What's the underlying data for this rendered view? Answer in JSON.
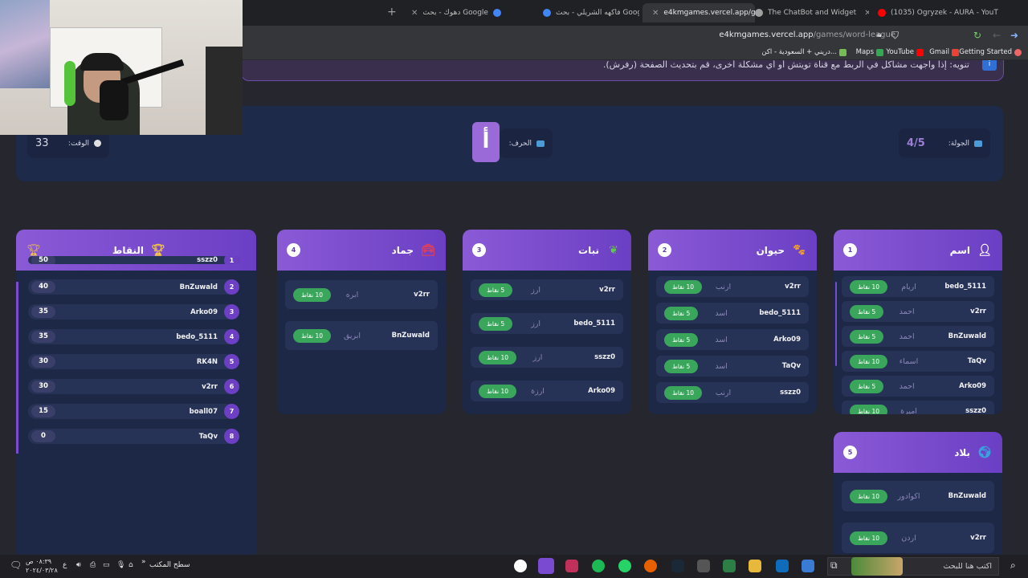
{
  "browser": {
    "tabs": [
      {
        "label": "مرحباً، الرئيسي - Ogryzek - AURA - (1035)",
        "display": "(1035) Ogryzek - AURA - YouT"
      },
      {
        "label": "The ChatBot and Widget",
        "display": "The ChatBot and Widget"
      },
      {
        "label": "e4kmgames.vercel.app/games",
        "display": "e4kmgames.vercel.app/game"
      },
      {
        "label": "فاكهه الشريلي - بحث Google",
        "display": "فاكهه الشريلي - بحث Google"
      },
      {
        "label": "دهوك - بحث Google",
        "display": "دهوك - بحث Google"
      }
    ],
    "url_domain": "e4kmgames.vercel.app",
    "url_path": "/games/word-league",
    "bookmarks": [
      "Getting Started",
      "Gmail",
      "YouTube",
      "Maps",
      "دريني + السعودية - اكن..."
    ]
  },
  "notice": {
    "text": "تنويه: إذا واجهت مشاكل في الربط مع قناة تويتش أو أي مشكلة أخرى، قم بتحديث الصفحة (رفرش)."
  },
  "header": {
    "round_label": "الجولة:",
    "round_value": "4/5",
    "letter_label": "الحرف:",
    "letter": "أ",
    "time_label": "الوقت:",
    "time_value": "33"
  },
  "categories": [
    {
      "number": "1",
      "title": "اسم",
      "icon": "person-icon",
      "rows": [
        {
          "name": "bedo_5111",
          "word": "اريام",
          "points": "10 نقاط"
        },
        {
          "name": "v2rr",
          "word": "احمد",
          "points": "5 نقاط"
        },
        {
          "name": "BnZuwald",
          "word": "احمد",
          "points": "5 نقاط"
        },
        {
          "name": "TaQv",
          "word": "اسماء",
          "points": "10 نقاط"
        },
        {
          "name": "Arko09",
          "word": "احمد",
          "points": "5 نقاط"
        },
        {
          "name": "sszz0",
          "word": "اميرة",
          "points": "10 نقاط"
        }
      ]
    },
    {
      "number": "2",
      "title": "حيوان",
      "icon": "paw-icon",
      "rows": [
        {
          "name": "v2rr",
          "word": "ارنب",
          "points": "10 نقاط"
        },
        {
          "name": "bedo_5111",
          "word": "اسد",
          "points": "5 نقاط"
        },
        {
          "name": "Arko09",
          "word": "اسد",
          "points": "5 نقاط"
        },
        {
          "name": "TaQv",
          "word": "اسد",
          "points": "5 نقاط"
        },
        {
          "name": "sszz0",
          "word": "ارنب",
          "points": "10 نقاط"
        }
      ]
    },
    {
      "number": "3",
      "title": "نبات",
      "icon": "leaf-icon",
      "rows": [
        {
          "name": "v2rr",
          "word": "ارز",
          "points": "5 نقاط"
        },
        {
          "name": "bedo_5111",
          "word": "ارز",
          "points": "5 نقاط"
        },
        {
          "name": "sszz0",
          "word": "ارز",
          "points": "10 نقاط"
        },
        {
          "name": "Arko09",
          "word": "ارزة",
          "points": "10 نقاط"
        }
      ]
    },
    {
      "number": "4",
      "title": "جماد",
      "icon": "toolbox-icon",
      "rows": [
        {
          "name": "v2rr",
          "word": "ابره",
          "points": "10 نقاط"
        },
        {
          "name": "BnZuwald",
          "word": "ابريق",
          "points": "10 نقاط"
        }
      ]
    },
    {
      "number": "5",
      "title": "بلاد",
      "icon": "globe-icon",
      "rows": [
        {
          "name": "BnZuwald",
          "word": "اكوادور",
          "points": "10 نقاط"
        },
        {
          "name": "v2rr",
          "word": "اردن",
          "points": "10 نقاط"
        }
      ]
    }
  ],
  "leaderboard": {
    "title": "النقاط",
    "partial_top": {
      "rank": "1",
      "name": "sszz0",
      "score": "50"
    },
    "players": [
      {
        "rank": "2",
        "name": "BnZuwald",
        "score": "40"
      },
      {
        "rank": "3",
        "name": "Arko09",
        "score": "35"
      },
      {
        "rank": "4",
        "name": "bedo_5111",
        "score": "35"
      },
      {
        "rank": "5",
        "name": "RK4N",
        "score": "30"
      },
      {
        "rank": "6",
        "name": "v2rr",
        "score": "30"
      },
      {
        "rank": "7",
        "name": "boall07",
        "score": "15"
      },
      {
        "rank": "8",
        "name": "TaQv",
        "score": "0"
      }
    ]
  },
  "taskbar": {
    "search_placeholder": "اكتب هنا للبحث",
    "desktop_label": "سطح المكتب",
    "time": "٠٨:٣٩ ص",
    "date": "٢٠٢٤/٠٣/٢٨",
    "lang": "ع"
  },
  "colors": {
    "accent": "#7a4ad0",
    "points_green": "#3aa65c",
    "card_bg": "#1d2847",
    "page_bg": "#26262e"
  }
}
